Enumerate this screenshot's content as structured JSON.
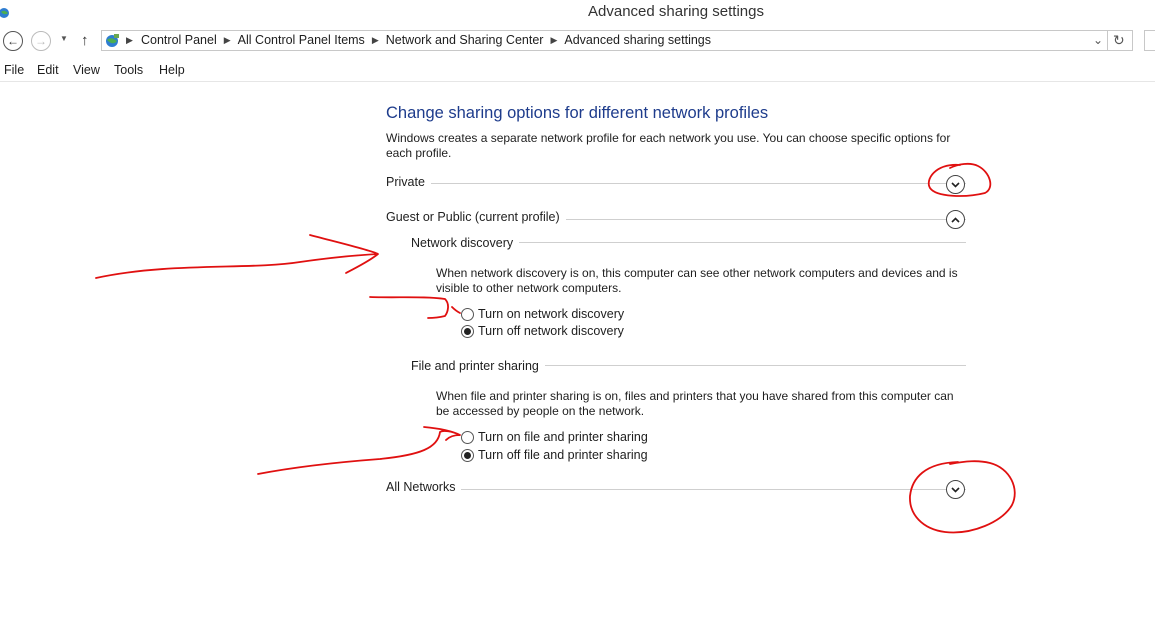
{
  "window": {
    "title": "Advanced sharing settings"
  },
  "address_bar": {
    "breadcrumbs": [
      "Control Panel",
      "All Control Panel Items",
      "Network and Sharing Center",
      "Advanced sharing settings"
    ],
    "icons": {
      "back": "back-arrow-icon",
      "forward": "forward-arrow-icon",
      "recent": "chevron-down-icon",
      "up": "up-arrow-icon",
      "location": "network-globe-icon",
      "dropdown": "chevron-down-icon",
      "refresh": "refresh-icon"
    }
  },
  "menu": {
    "items": [
      "File",
      "Edit",
      "View",
      "Tools",
      "Help"
    ]
  },
  "main": {
    "heading": "Change sharing options for different network profiles",
    "intro": "Windows creates a separate network profile for each network you use. You can choose specific options for each profile.",
    "profiles": {
      "private": {
        "label": "Private",
        "expanded": false
      },
      "guest_public": {
        "label": "Guest or Public (current profile)",
        "expanded": true
      },
      "all_networks": {
        "label": "All Networks",
        "expanded": false
      }
    },
    "network_discovery": {
      "label": "Network discovery",
      "description": "When network discovery is on, this computer can see other network computers and devices and is visible to other network computers.",
      "options": [
        {
          "label": "Turn on network discovery",
          "checked": false
        },
        {
          "label": "Turn off network discovery",
          "checked": true
        }
      ]
    },
    "file_printer_sharing": {
      "label": "File and printer sharing",
      "description": "When file and printer sharing is on, files and printers that you have shared from this computer can be accessed by people on the network.",
      "options": [
        {
          "label": "Turn on file and printer sharing",
          "checked": false
        },
        {
          "label": "Turn off file and printer sharing",
          "checked": true
        }
      ]
    }
  },
  "colors": {
    "heading": "#1e3c8c",
    "annotation": "#e01010"
  }
}
